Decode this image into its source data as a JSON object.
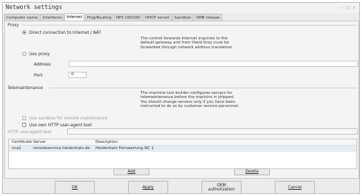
{
  "window": {
    "title": "Network settings"
  },
  "tabs": [
    "Computer name",
    "Interfaces",
    "Internet",
    "Ping/Routing",
    "NFS UID/GID",
    "DHCP server",
    "Sandbox",
    "SMB release"
  ],
  "active_tab": "Internet",
  "proxy": {
    "section_label": "Proxy",
    "direct_label": "Direct connection to Internet / NAT",
    "direct_info": "The control forwards Internet inquiries to the\ndefault gateway and from there they must be\nforwarded through network address translation.",
    "use_proxy_label": "Use proxy",
    "address_label": "Address:",
    "address_value": "",
    "port_label": "Port:",
    "port_value": "0"
  },
  "telemaintenance": {
    "section_label": "Telemaintenance",
    "info": "The machine tool builder configures servers for\ntelemaintenance before the machine is shipped.\nYou should change servers only if you have been\ninstructed to do so by customer service personnel.",
    "sandbox_label": "Use sandbox for remote maintenance",
    "own_agent_label": "Use own HTTP user-agent text",
    "agent_field_label": "HTTP user-agent text",
    "agent_value": "",
    "columns": [
      "Certificate",
      "Server",
      "Description"
    ],
    "rows": [
      {
        "certificate": "nca2",
        "server": "remoteservice.heidenhain.de",
        "description": "Heidenhain Fernwartung NC 1"
      }
    ],
    "add_label": "Add",
    "delete_label": "Delete"
  },
  "footer": {
    "ok_label": "OK",
    "apply_label": "Apply",
    "oem_line1": "OEM",
    "oem_line2": "authorization",
    "cancel_label": "Cancel"
  }
}
